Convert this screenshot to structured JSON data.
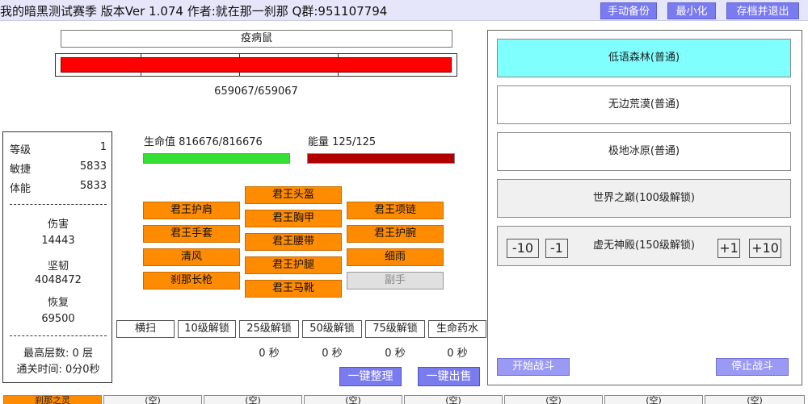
{
  "titlebar": {
    "title": "我的暗黑测试赛季  版本Ver 1.074  作者:就在那一刹那  Q群:951107794",
    "buttons": [
      "手动备份",
      "最小化",
      "存档并退出"
    ]
  },
  "monster": {
    "name": "疫病鼠",
    "hp_text": "659067/659067",
    "hp_fraction": 1.0
  },
  "stats": {
    "rows": [
      {
        "label": "等级",
        "value": "1"
      },
      {
        "label": "敏捷",
        "value": "5833"
      },
      {
        "label": "体能",
        "value": "5833"
      }
    ],
    "damage_label": "伤害",
    "damage_value": "14443",
    "tough_label": "坚韧",
    "tough_value": "4048472",
    "recover_label": "恢复",
    "recover_value": "69500",
    "max_floor": "最高层数: 0 层",
    "clear_time": "通关时间: 0分0秒"
  },
  "hero": {
    "hp_label": "生命值 816676/816676",
    "mp_label": "能量 125/125",
    "hp_fraction": 1.0,
    "mp_fraction": 1.0
  },
  "equipment": {
    "left": [
      "君王护肩",
      "君王手套",
      "清风",
      "刹那长枪"
    ],
    "middle": [
      "君王头盔",
      "君王胸甲",
      "君王腰带",
      "君王护腿",
      "君王马靴"
    ],
    "right": [
      "君王项链",
      "君王护腕",
      "细雨",
      "副手"
    ]
  },
  "skills": {
    "labels": [
      "横扫",
      "10级解锁",
      "25级解锁",
      "50级解锁",
      "75级解锁",
      "生命药水"
    ],
    "cooldowns": [
      "0 秒",
      "0 秒",
      "0 秒",
      "0 秒"
    ]
  },
  "actions": {
    "sort": "一键整理",
    "sell": "一键出售"
  },
  "maps": {
    "items": [
      "低语森林(普通)",
      "无边荒漠(普通)",
      "极地冰原(普通)",
      "世界之巅(100级解锁)"
    ],
    "selected": 0,
    "stepper_label": "虚无神殿(150级解锁)",
    "steps": [
      "-10",
      "-1",
      "+1",
      "+10"
    ],
    "start": "开始战斗",
    "stop": "停止战斗"
  },
  "tabs": [
    "刹那之灵",
    "(空)",
    "(空)",
    "(空)",
    "(空)",
    "(空)",
    "(空)",
    "(空)"
  ],
  "colors": {
    "accent": "#7b7bf0",
    "equip": "#ff8c00",
    "selected_map": "#80ffff",
    "hp": "#33e033",
    "mp": "#b00000",
    "monster_hp": "#ff0000"
  }
}
